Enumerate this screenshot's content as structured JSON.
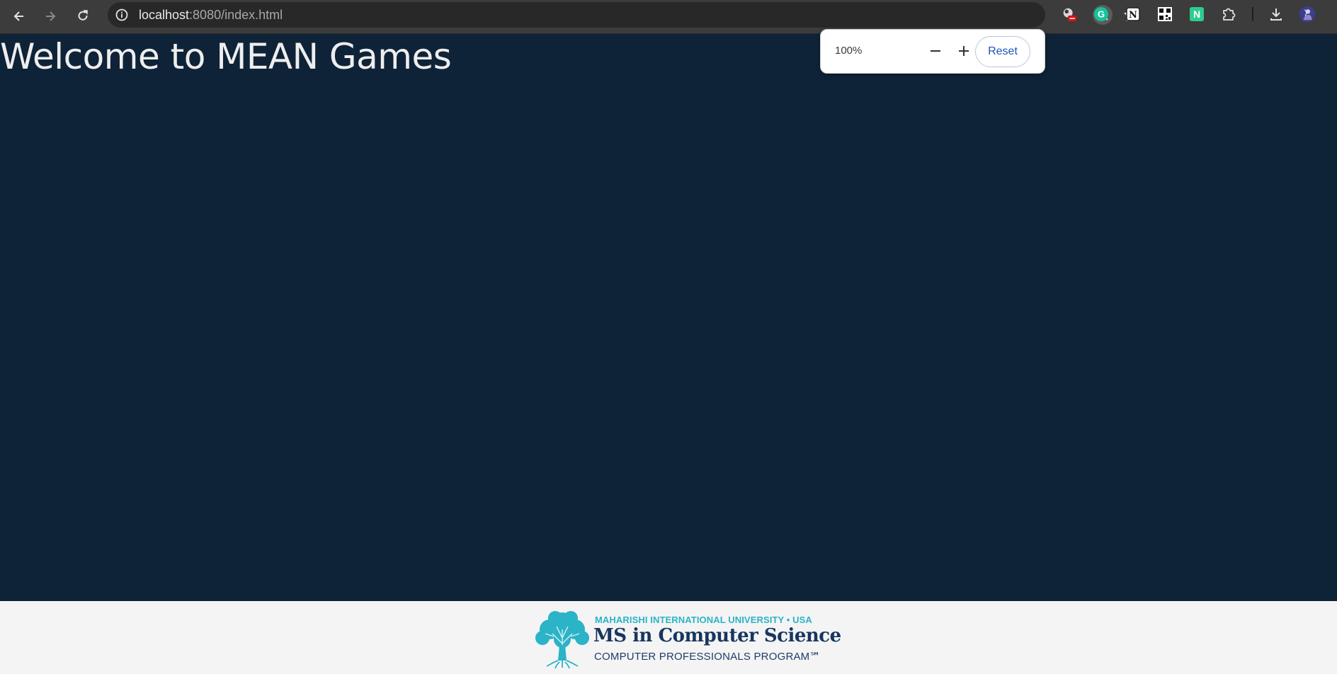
{
  "browser": {
    "url_host": "localhost",
    "url_path": ":8080/index.html",
    "icons": {
      "back": "back-arrow-icon",
      "forward": "forward-arrow-icon",
      "reload": "reload-icon",
      "site_info": "site-info-icon",
      "zoom": "zoom-icon",
      "bookmark": "star-icon",
      "downloads": "download-icon",
      "profile": "profile-avatar"
    },
    "extensions": [
      {
        "name": "extension-blocked-icon",
        "glyph": ""
      },
      {
        "name": "grammarly-icon",
        "glyph": "G"
      },
      {
        "name": "notion-icon",
        "glyph": "N"
      },
      {
        "name": "qr-code-icon",
        "glyph": ""
      },
      {
        "name": "n-extension-icon",
        "glyph": "N"
      },
      {
        "name": "puzzle-extensions-icon",
        "glyph": ""
      }
    ]
  },
  "zoom_popup": {
    "level": "100%",
    "minus": "−",
    "plus": "+",
    "reset": "Reset"
  },
  "page": {
    "title": "Welcome to MEAN Games",
    "background": "#0f2338"
  },
  "footer": {
    "line1": "MAHARISHI INTERNATIONAL UNIVERSITY • USA",
    "line2": "MS in Computer Science",
    "line3": "COMPUTER PROFESSIONALS PROGRAM℠"
  }
}
